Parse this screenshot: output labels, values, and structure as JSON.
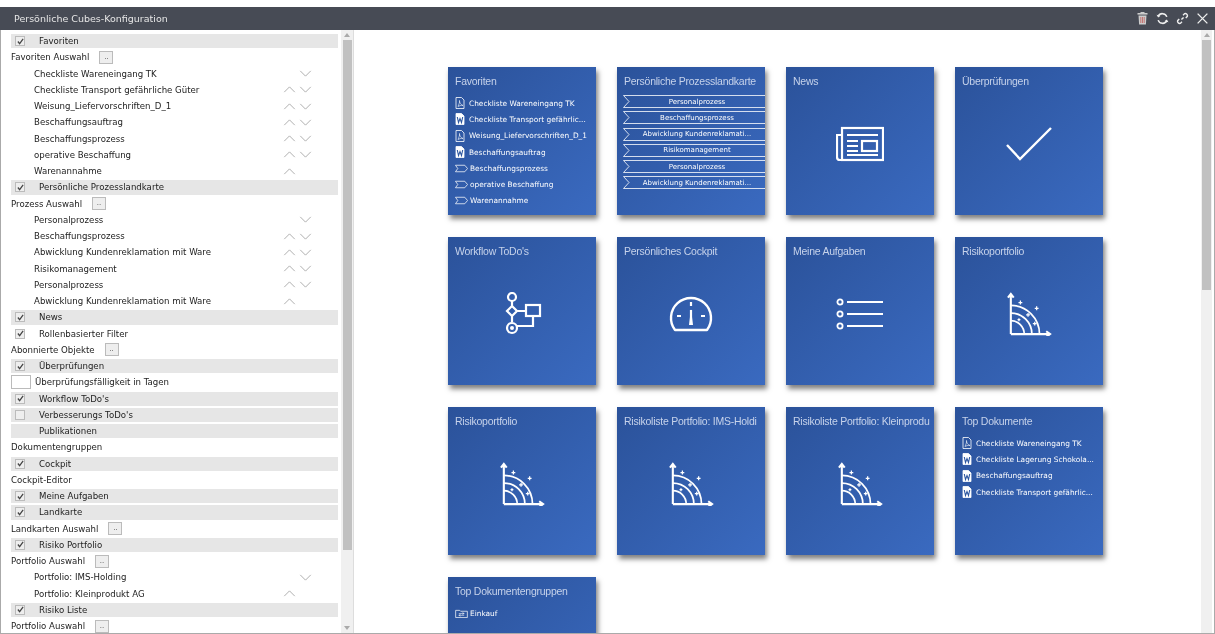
{
  "window": {
    "title": "Persönliche Cubes-Konfiguration"
  },
  "settings": [
    {
      "kind": "section",
      "label": "Favoriten",
      "checked": true
    },
    {
      "kind": "picker",
      "label": "Favoriten Auswahl",
      "button": ".."
    },
    {
      "kind": "item",
      "label": "Checkliste Wareneingang TK",
      "up": false,
      "down": true
    },
    {
      "kind": "item",
      "label": "Checkliste Transport gefährliche Güter",
      "up": true,
      "down": true
    },
    {
      "kind": "item",
      "label": "Weisung_Liefervorschriften_D_1",
      "up": true,
      "down": true
    },
    {
      "kind": "item",
      "label": "Beschaffungsauftrag",
      "up": true,
      "down": true
    },
    {
      "kind": "item",
      "label": "Beschaffungsprozess",
      "up": true,
      "down": true
    },
    {
      "kind": "item",
      "label": "operative Beschaffung",
      "up": true,
      "down": true
    },
    {
      "kind": "item",
      "label": "Warenannahme",
      "up": true,
      "down": false
    },
    {
      "kind": "section",
      "label": "Persönliche Prozesslandkarte",
      "checked": true
    },
    {
      "kind": "picker",
      "label": "Prozess Auswahl",
      "button": ".."
    },
    {
      "kind": "item",
      "label": "Personalprozess",
      "up": false,
      "down": true
    },
    {
      "kind": "item",
      "label": "Beschaffungsprozess",
      "up": true,
      "down": true
    },
    {
      "kind": "item",
      "label": "Abwicklung Kundenreklamation mit Ware",
      "up": true,
      "down": true
    },
    {
      "kind": "item",
      "label": "Risikomanagement",
      "up": true,
      "down": true
    },
    {
      "kind": "item",
      "label": "Personalprozess",
      "up": true,
      "down": true
    },
    {
      "kind": "item",
      "label": "Abwicklung Kundenreklamation mit Ware",
      "up": true,
      "down": false
    },
    {
      "kind": "section",
      "label": "News",
      "checked": true
    },
    {
      "kind": "check",
      "label": "Rollenbasierter Filter",
      "checked": true
    },
    {
      "kind": "picker",
      "label": "Abonnierte Objekte",
      "button": ".."
    },
    {
      "kind": "section",
      "label": "Überprüfungen",
      "checked": true
    },
    {
      "kind": "input",
      "label": "Überprüfungsfälligkeit in Tagen"
    },
    {
      "kind": "section",
      "label": "Workflow ToDo's",
      "checked": true
    },
    {
      "kind": "section",
      "label": "Verbesserungs ToDo's",
      "checked": false
    },
    {
      "kind": "heading",
      "label": "Publikationen"
    },
    {
      "kind": "text",
      "label": "Dokumentengruppen"
    },
    {
      "kind": "section",
      "label": "Cockpit",
      "checked": true
    },
    {
      "kind": "text",
      "label": "Cockpit-Editor"
    },
    {
      "kind": "section",
      "label": "Meine Aufgaben",
      "checked": true
    },
    {
      "kind": "section",
      "label": "Landkarte",
      "checked": true
    },
    {
      "kind": "picker",
      "label": "Landkarten Auswahl",
      "button": ".."
    },
    {
      "kind": "section",
      "label": "Risiko Portfolio",
      "checked": true
    },
    {
      "kind": "picker",
      "label": "Portfolio Auswahl",
      "button": ".."
    },
    {
      "kind": "item",
      "label": "Portfolio: IMS-Holding",
      "up": false,
      "down": true
    },
    {
      "kind": "item",
      "label": "Portfolio: Kleinprodukt AG",
      "up": true,
      "down": false
    },
    {
      "kind": "section",
      "label": "Risiko Liste",
      "checked": true
    },
    {
      "kind": "picker",
      "label": "Portfolio Auswahl",
      "button": ".."
    }
  ],
  "tiles": [
    {
      "kind": "documents",
      "title": "Favoriten",
      "items": [
        {
          "kind": "pdf",
          "label": "Checkliste Wareneingang TK"
        },
        {
          "kind": "word",
          "label": "Checkliste Transport gefährlic..."
        },
        {
          "kind": "pdf",
          "label": "Weisung_Liefervorschriften_D_1"
        },
        {
          "kind": "word",
          "label": "Beschaffungsauftrag"
        },
        {
          "kind": "process",
          "label": "Beschaffungsprozess"
        },
        {
          "kind": "process",
          "label": "operative Beschaffung"
        },
        {
          "kind": "process",
          "label": "Warenannahme"
        }
      ]
    },
    {
      "kind": "process_map",
      "title": "Persönliche Prozesslandkarte",
      "steps": [
        "Personalprozess",
        "Beschaffungsprozess",
        "Abwicklung Kundenreklamati...",
        "Risikomanagement",
        "Personalprozess",
        "Abwicklung Kundenreklamati..."
      ]
    },
    {
      "kind": "news",
      "title": "News"
    },
    {
      "kind": "check",
      "title": "Überprüfungen"
    },
    {
      "kind": "workflow",
      "title": "Workflow ToDo's"
    },
    {
      "kind": "gauge",
      "title": "Persönliches Cockpit"
    },
    {
      "kind": "list",
      "title": "Meine Aufgaben"
    },
    {
      "kind": "risk",
      "title": "Risikoportfolio"
    },
    {
      "kind": "risk",
      "title": "Risikoportfolio"
    },
    {
      "kind": "risk",
      "title": "Risikoliste Portfolio: IMS-Holdi"
    },
    {
      "kind": "risk",
      "title": "Risikoliste Portfolio: Kleinprodu"
    },
    {
      "kind": "documents",
      "title": "Top Dokumente",
      "items": [
        {
          "kind": "pdf",
          "label": "Checkliste Wareneingang TK"
        },
        {
          "kind": "word",
          "label": "Checkliste Lagerung Schokola..."
        },
        {
          "kind": "word",
          "label": "Beschaffungsauftrag"
        },
        {
          "kind": "word",
          "label": "Checkliste Transport gefährlic..."
        }
      ]
    },
    {
      "kind": "documents",
      "title": "Top Dokumentengruppen",
      "items": [
        {
          "kind": "folder",
          "label": "Einkauf"
        }
      ]
    }
  ]
}
